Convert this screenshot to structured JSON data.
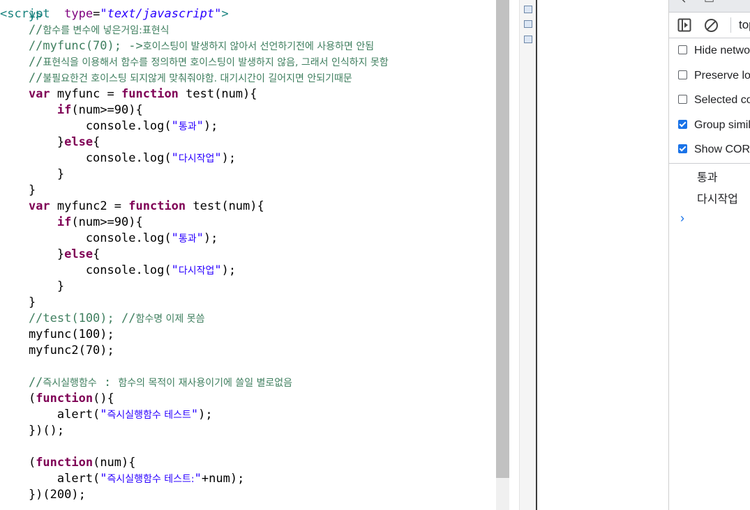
{
  "editor": {
    "top_partial": "y>",
    "lines": [
      [
        [
          "tag",
          "<"
        ],
        [
          "tag",
          "script"
        ],
        [
          "",
          "  "
        ],
        [
          "attr",
          "type"
        ],
        [
          "",
          "="
        ],
        [
          "astr",
          "\"text/javascript\""
        ],
        [
          "tag",
          ">"
        ]
      ],
      [
        [
          "cmt",
          "    //"
        ],
        [
          "cmt kr",
          "함수를 변수에 넣은거임:표현식"
        ]
      ],
      [
        [
          "cmt",
          "    //myfunc(70); ->"
        ],
        [
          "cmt kr",
          "호이스팅이 발생하지 않아서 선언하기전에 사용하면 안됨"
        ]
      ],
      [
        [
          "cmt",
          "    //"
        ],
        [
          "cmt kr",
          "표현식을 이용해서 함수를 정의하면 호이스팅이 발생하지 않음, 그래서 인식하지 못함"
        ]
      ],
      [
        [
          "cmt",
          "    //"
        ],
        [
          "cmt kr",
          "불필요한건 호이스팅 되지않게 맞춰줘야함. 대기시간이 길어지면 안되기때문"
        ]
      ],
      [
        [
          "",
          "    "
        ],
        [
          "kw",
          "var"
        ],
        [
          "",
          " myfunc = "
        ],
        [
          "kw",
          "function"
        ],
        [
          "",
          " test(num){"
        ]
      ],
      [
        [
          "",
          "        "
        ],
        [
          "kw",
          "if"
        ],
        [
          "",
          "(num>=90){"
        ]
      ],
      [
        [
          "",
          "            console.log("
        ],
        [
          "str",
          "\""
        ],
        [
          "str kr",
          "통과"
        ],
        [
          "str",
          "\""
        ],
        [
          "",
          ");"
        ]
      ],
      [
        [
          "",
          "        }"
        ],
        [
          "kw",
          "else"
        ],
        [
          "",
          "{"
        ]
      ],
      [
        [
          "",
          "            console.log("
        ],
        [
          "str",
          "\""
        ],
        [
          "str kr",
          "다시작업"
        ],
        [
          "str",
          "\""
        ],
        [
          "",
          ");"
        ]
      ],
      [
        [
          "",
          "        }"
        ]
      ],
      [
        [
          "",
          "    }"
        ]
      ],
      [
        [
          "",
          "    "
        ],
        [
          "kw",
          "var"
        ],
        [
          "",
          " myfunc2 = "
        ],
        [
          "kw",
          "function"
        ],
        [
          "",
          " test(num){"
        ]
      ],
      [
        [
          "",
          "        "
        ],
        [
          "kw",
          "if"
        ],
        [
          "",
          "(num>=90){"
        ]
      ],
      [
        [
          "",
          "            console.log("
        ],
        [
          "str",
          "\""
        ],
        [
          "str kr",
          "통과"
        ],
        [
          "str",
          "\""
        ],
        [
          "",
          ");"
        ]
      ],
      [
        [
          "",
          "        }"
        ],
        [
          "kw",
          "else"
        ],
        [
          "",
          "{"
        ]
      ],
      [
        [
          "",
          "            console.log("
        ],
        [
          "str",
          "\""
        ],
        [
          "str kr",
          "다시작업"
        ],
        [
          "str",
          "\""
        ],
        [
          "",
          ");"
        ]
      ],
      [
        [
          "",
          "        }"
        ]
      ],
      [
        [
          "",
          "    }"
        ]
      ],
      [
        [
          "cmt",
          "    //test(100); //"
        ],
        [
          "cmt kr",
          "함수명 이제 못씀"
        ]
      ],
      [
        [
          "",
          "    myfunc(100);"
        ]
      ],
      [
        [
          "",
          "    myfunc2(70);"
        ]
      ],
      [
        [
          "",
          ""
        ]
      ],
      [
        [
          "cmt",
          "    //"
        ],
        [
          "cmt kr",
          "즉시실행함수"
        ],
        [
          "cmt",
          " : "
        ],
        [
          "cmt kr",
          "함수의 목적이 재사용이기에 쓸일 별로없음"
        ]
      ],
      [
        [
          "",
          "    ("
        ],
        [
          "kw",
          "function"
        ],
        [
          "",
          "(){"
        ]
      ],
      [
        [
          "",
          "        alert("
        ],
        [
          "str",
          "\""
        ],
        [
          "str kr",
          "즉시실행함수 테스트"
        ],
        [
          "str",
          "\""
        ],
        [
          "",
          ");"
        ]
      ],
      [
        [
          "",
          "    })();"
        ]
      ],
      [
        [
          "",
          ""
        ]
      ],
      [
        [
          "",
          "    ("
        ],
        [
          "kw",
          "function"
        ],
        [
          "",
          "(num){"
        ]
      ],
      [
        [
          "",
          "        alert("
        ],
        [
          "str",
          "\""
        ],
        [
          "str kr",
          "즉시실행함수 테스트:"
        ],
        [
          "str",
          "\""
        ],
        [
          "",
          "+num);"
        ]
      ],
      [
        [
          "",
          "    })(200);"
        ]
      ]
    ]
  },
  "devtools": {
    "context_selector": "top",
    "options": [
      {
        "label": "Hide network",
        "checked": false
      },
      {
        "label": "Preserve log",
        "checked": false
      },
      {
        "label": "Selected context only",
        "checked": false
      },
      {
        "label": "Group similar messages in console",
        "checked": true
      },
      {
        "label": "Show CORS errors in console",
        "checked": true
      }
    ],
    "messages": [
      "통과",
      "다시작업"
    ],
    "prompt_symbol": "›"
  }
}
